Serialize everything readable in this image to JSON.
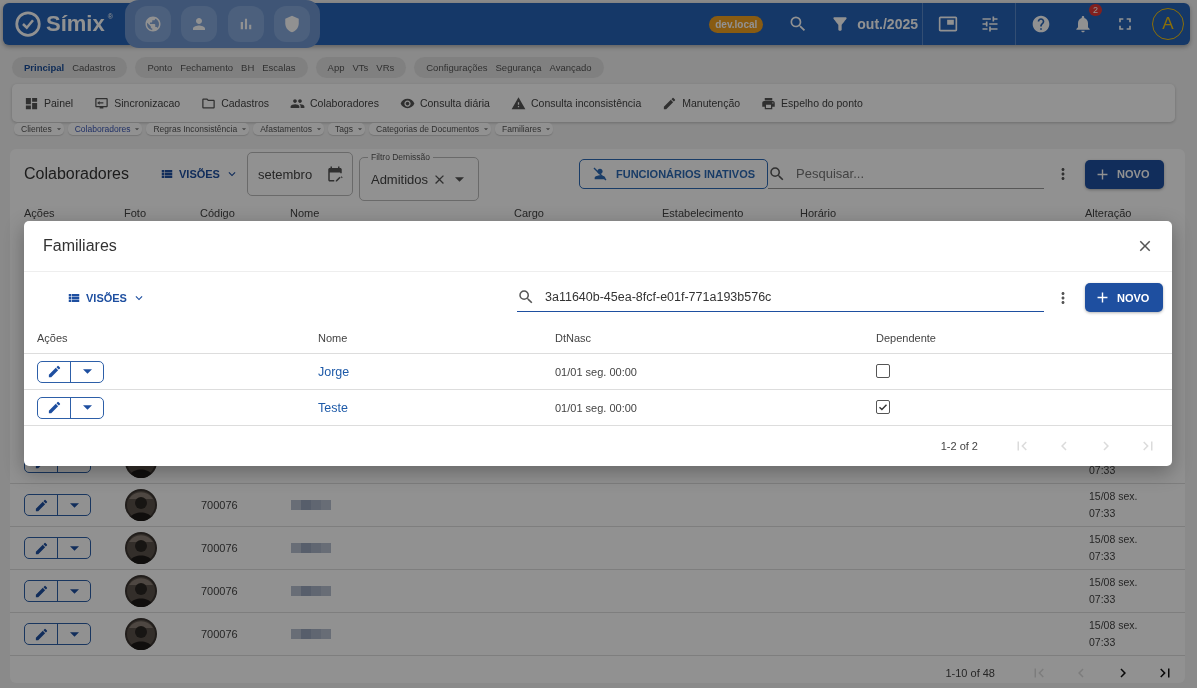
{
  "top_bar": {
    "logo": "Símix",
    "logo_mark": "®",
    "env_badge": "dev.local",
    "period": "out./2025",
    "notification_count": "2",
    "avatar": "A"
  },
  "module_groups": [
    [
      {
        "label": "Principal",
        "selected": true
      },
      {
        "label": "Cadastros",
        "selected": false
      }
    ],
    [
      {
        "label": "Ponto",
        "selected": false
      },
      {
        "label": "Fechamento",
        "selected": false
      },
      {
        "label": "BH",
        "selected": false
      },
      {
        "label": "Escalas",
        "selected": false
      }
    ],
    [
      {
        "label": "App",
        "selected": false
      },
      {
        "label": "VTs",
        "selected": false
      },
      {
        "label": "VRs",
        "selected": false
      }
    ],
    [
      {
        "label": "Configurações",
        "selected": false
      },
      {
        "label": "Segurança",
        "selected": false
      },
      {
        "label": "Avançado",
        "selected": false
      }
    ]
  ],
  "menu": [
    "Painel",
    "Sincronizacao",
    "Cadastros",
    "Colaboradores",
    "Consulta diária",
    "Consulta inconsistência",
    "Manutenção",
    "Espelho do ponto"
  ],
  "breadcrumbs": [
    {
      "label": "Clientes",
      "selected": false
    },
    {
      "label": "Colaboradores",
      "selected": true
    },
    {
      "label": "Regras Inconsistência",
      "selected": false
    },
    {
      "label": "Afastamentos",
      "selected": false
    },
    {
      "label": "Tags",
      "selected": false
    },
    {
      "label": "Categorias de Documentos",
      "selected": false
    },
    {
      "label": "Familiares",
      "selected": false
    }
  ],
  "page": {
    "title": "Colaboradores",
    "views_button": "VISÕES",
    "month": "setembro",
    "filter": {
      "label": "Filtro Demissão",
      "value": "Admitidos"
    },
    "inactive_button": "FUNCIONÁRIOS INATIVOS",
    "search": {
      "placeholder": "Pesquisar..."
    },
    "new_button": "NOVO"
  },
  "table": {
    "columns": [
      "Ações",
      "Foto",
      "Código",
      "Nome",
      "Cargo",
      "Estabelecimento",
      "Horário",
      "Alteração"
    ],
    "rows": [
      {
        "time": "07:33"
      },
      {
        "code": "700076",
        "date": "15/08 sex.",
        "time": "07:33"
      },
      {
        "code": "700076",
        "date": "15/08 sex.",
        "time": "07:33"
      },
      {
        "code": "700076",
        "date": "15/08 sex.",
        "time": "07:33"
      },
      {
        "code": "700076",
        "date": "15/08 sex.",
        "time": "07:33"
      }
    ],
    "pagination": "1-10 of 48",
    "pager": [
      {
        "disabled": true
      },
      {
        "disabled": true
      },
      {
        "disabled": false
      },
      {
        "disabled": false
      }
    ]
  },
  "dialog": {
    "title": "Familiares",
    "views_button": "VISÕES",
    "search": {
      "value": "3a11640b-45ea-8fcf-e01f-771a193b576c"
    },
    "new_button": "NOVO",
    "columns": [
      "Ações",
      "Nome",
      "DtNasc",
      "Dependente"
    ],
    "rows": [
      {
        "name": "Jorge",
        "birth": "01/01 seg. 00:00",
        "dependent": false
      },
      {
        "name": "Teste",
        "birth": "01/01 seg. 00:00",
        "dependent": true
      }
    ],
    "pagination": "1-2 of 2",
    "pager": [
      {
        "disabled": true
      },
      {
        "disabled": true
      },
      {
        "disabled": true
      },
      {
        "disabled": true
      }
    ]
  }
}
